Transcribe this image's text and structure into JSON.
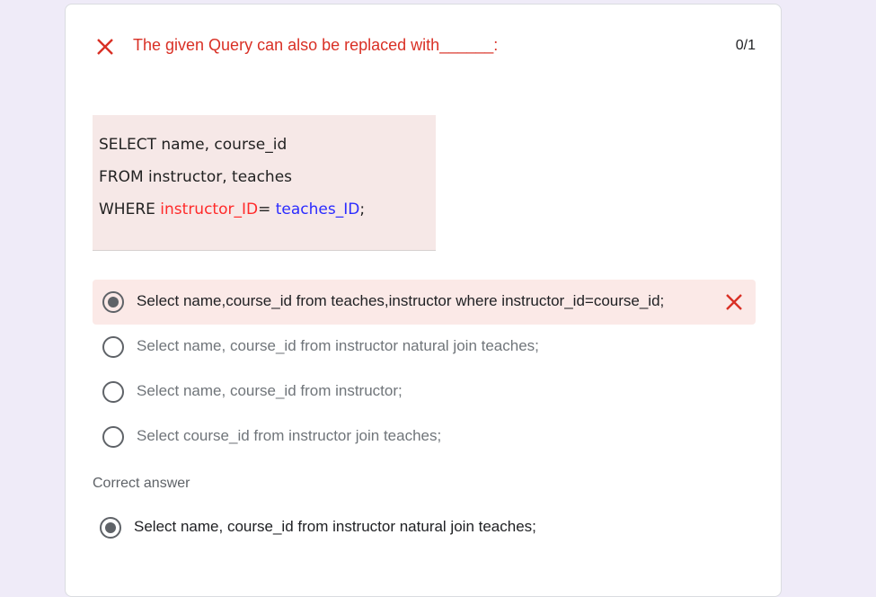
{
  "question": {
    "title": "The given Query can also be replaced with______:",
    "score": "0/1",
    "status_icon": "close-icon",
    "status_color": "#d93025"
  },
  "query": {
    "line1": "SELECT name, course_id",
    "line2": "FROM instructor, teaches",
    "line3_prefix": "WHERE ",
    "line3_red": "instructor_ID",
    "line3_mid": "= ",
    "line3_blue": "teaches_ID",
    "line3_suffix": ";"
  },
  "options": [
    {
      "label": "Select name,course_id from teaches,instructor where instructor_id=course_id;",
      "selected": true,
      "result": "incorrect"
    },
    {
      "label": "Select name, course_id from instructor natural join teaches;",
      "selected": false
    },
    {
      "label": "Select name, course_id from instructor;",
      "selected": false
    },
    {
      "label": "Select course_id from instructor join teaches;",
      "selected": false
    }
  ],
  "correct": {
    "heading": "Correct answer",
    "answer": "Select name, course_id from instructor natural join teaches;"
  },
  "colors": {
    "wrong_red": "#d93025",
    "selected_bg": "#fbe9e7",
    "query_bg": "#f6e8e7",
    "page_bg": "#efebf8"
  }
}
